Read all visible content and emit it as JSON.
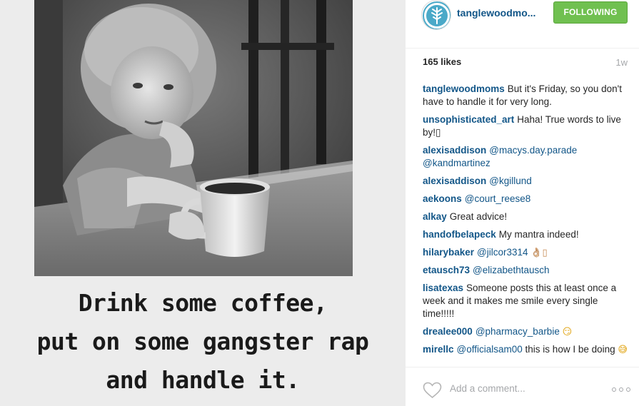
{
  "post": {
    "image": {
      "alt_icon": "photo-of-child-with-coffee-mug",
      "caption_lines": [
        "Drink some coffee,",
        "put on some gangster rap",
        "and handle it."
      ]
    }
  },
  "header": {
    "username": "tanglewoodmo...",
    "follow_label": "FOLLOWING",
    "avatar_icon": "tree-logo-icon",
    "follow_color": "#70c050"
  },
  "meta": {
    "likes": "165 likes",
    "time": "1w"
  },
  "comments": [
    {
      "user": "tanglewoodmoms",
      "text": "But it's Friday, so you don't have to handle it for very long."
    },
    {
      "user": "unsophisticated_art",
      "text": "Haha! True words to live by!",
      "suffix": "▯"
    },
    {
      "user": "alexisaddison",
      "mention": "@macys.day.parade @kandmartinez",
      "text": ""
    },
    {
      "user": "alexisaddison",
      "mention": "@kgillund",
      "text": ""
    },
    {
      "user": "aekoons",
      "mention": "@court_reese8",
      "text": ""
    },
    {
      "user": "alkay",
      "text": "Great advice!"
    },
    {
      "user": "handofbelapeck",
      "text": "My mantra indeed!"
    },
    {
      "user": "hilarybaker",
      "mention": "@jilcor3314",
      "text": "",
      "suffix": "👌🏼▯"
    },
    {
      "user": "etausch73",
      "mention": "@elizabethtausch",
      "text": ""
    },
    {
      "user": "lisatexas",
      "text": "Someone posts this at least once a week and it makes me smile every single time!!!!!"
    },
    {
      "user": "drealee000",
      "mention": "@pharmacy_barbie",
      "text": "",
      "suffix": "😏"
    },
    {
      "user": "mirellc",
      "mention": "@officialsam00",
      "text": "this is how I be doing",
      "suffix": "😅"
    }
  ],
  "footer": {
    "add_comment_placeholder": "Add a comment...",
    "like_icon": "heart-outline-icon",
    "more_icon": "more-options-icon"
  }
}
